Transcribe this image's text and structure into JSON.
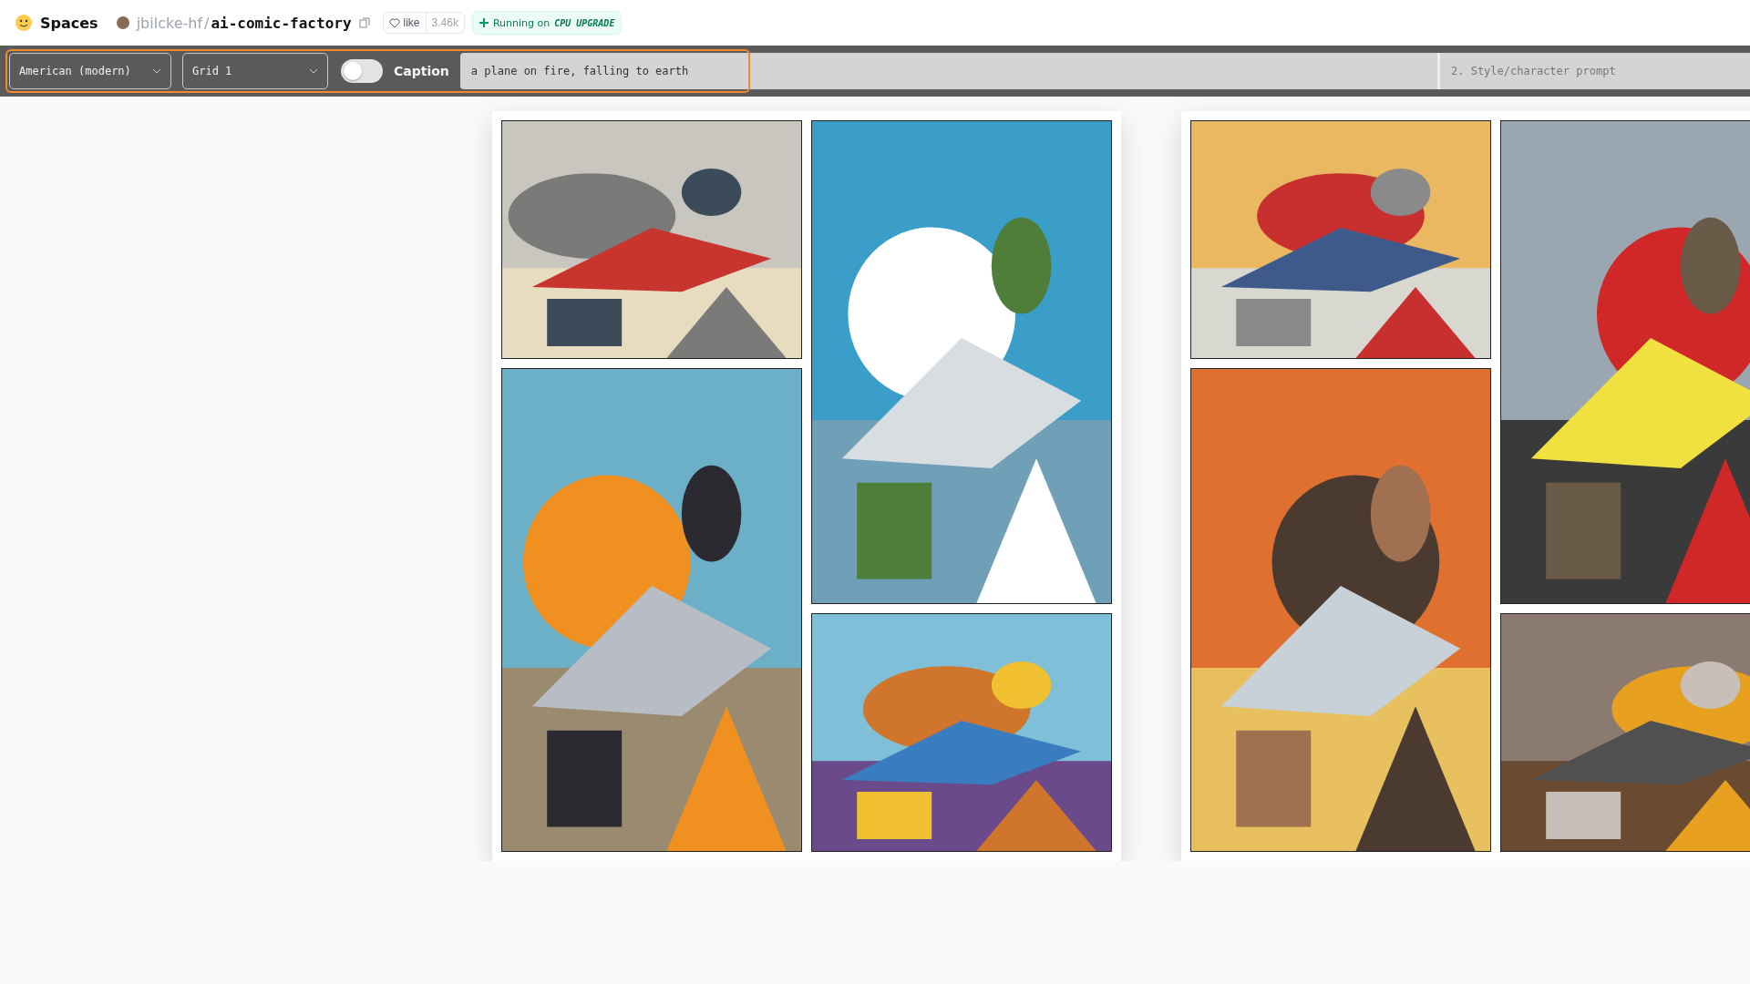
{
  "header": {
    "brand": "Spaces",
    "owner": "jbilcke-hf",
    "separator": "/",
    "repo": "ai-comic-factory",
    "like": {
      "label": "like",
      "count": "3.46k"
    },
    "status": {
      "prefix": "Running on",
      "hardware": "CPU UPGRADE"
    }
  },
  "toolbar": {
    "style_select": {
      "value": "American (modern)"
    },
    "layout_select": {
      "value": "Grid 1"
    },
    "caption_toggle": {
      "label": "Caption",
      "on": false
    },
    "story_prompt": {
      "value": "a plane on fire, falling to earth"
    },
    "style_prompt": {
      "placeholder": "2. Style/character prompt"
    }
  }
}
